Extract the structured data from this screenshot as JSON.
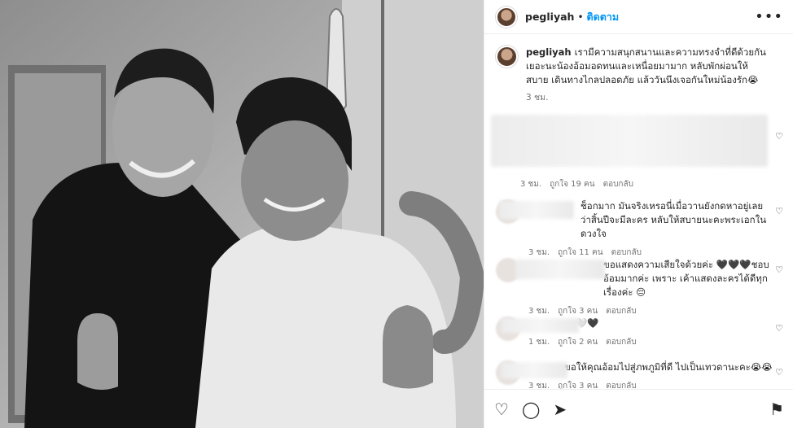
{
  "header": {
    "username": "pegliyah",
    "separator": "•",
    "follow_label": "ติดตาม",
    "more_label": "•••"
  },
  "caption": {
    "username": "pegliyah",
    "text": "เรามีความสนุกสนานและความทรงจำที่ดีด้วยกันเยอะนะน้องอ้อมอดทนและเหนื่อยมามาก หลับพักผ่อนให้สบาย เดินทางไกลปลอดภัย แล้ววันนึงเจอกันใหม่น้องรัก😭",
    "time": "3 ชม."
  },
  "comments": [
    {
      "text": "",
      "time": "3 ชม.",
      "likes": "ถูกใจ 19 คน",
      "reply": "ตอบกลับ"
    },
    {
      "text": "ช็อกมาก มันจริงเหรอนี่เมื่อวานยังกดหาอยู่เลยว่าสิ้นปีจะมีละคร หลับให้สบายนะคะพระเอกในดวงใจ",
      "time": "3 ชม.",
      "likes": "ถูกใจ 11 คน",
      "reply": "ตอบกลับ"
    },
    {
      "text": "ขอแสดงความเสียใจด้วยค่ะ 🖤🖤🖤ชอบอ้อมมากค่ะ เพราะ เค้าแสดงละครได้ดีทุกเรื่องค่ะ 😔",
      "time": "3 ชม.",
      "likes": "ถูกใจ 3 คน",
      "reply": "ตอบกลับ"
    },
    {
      "text": "🤍🖤",
      "time": "1 ชม.",
      "likes": "ถูกใจ 2 คน",
      "reply": "ตอบกลับ"
    },
    {
      "text": "ขอให้คุณอ้อมไปสู่ภพภูมิที่ดี ไปเป็นเทวดานะคะ😭😭",
      "time": "3 ชม.",
      "likes": "ถูกใจ 3 คน",
      "reply": "ตอบกลับ"
    }
  ],
  "icons": {
    "like": "heart-icon",
    "comment": "comment-icon",
    "share": "share-icon",
    "save": "bookmark-icon"
  }
}
